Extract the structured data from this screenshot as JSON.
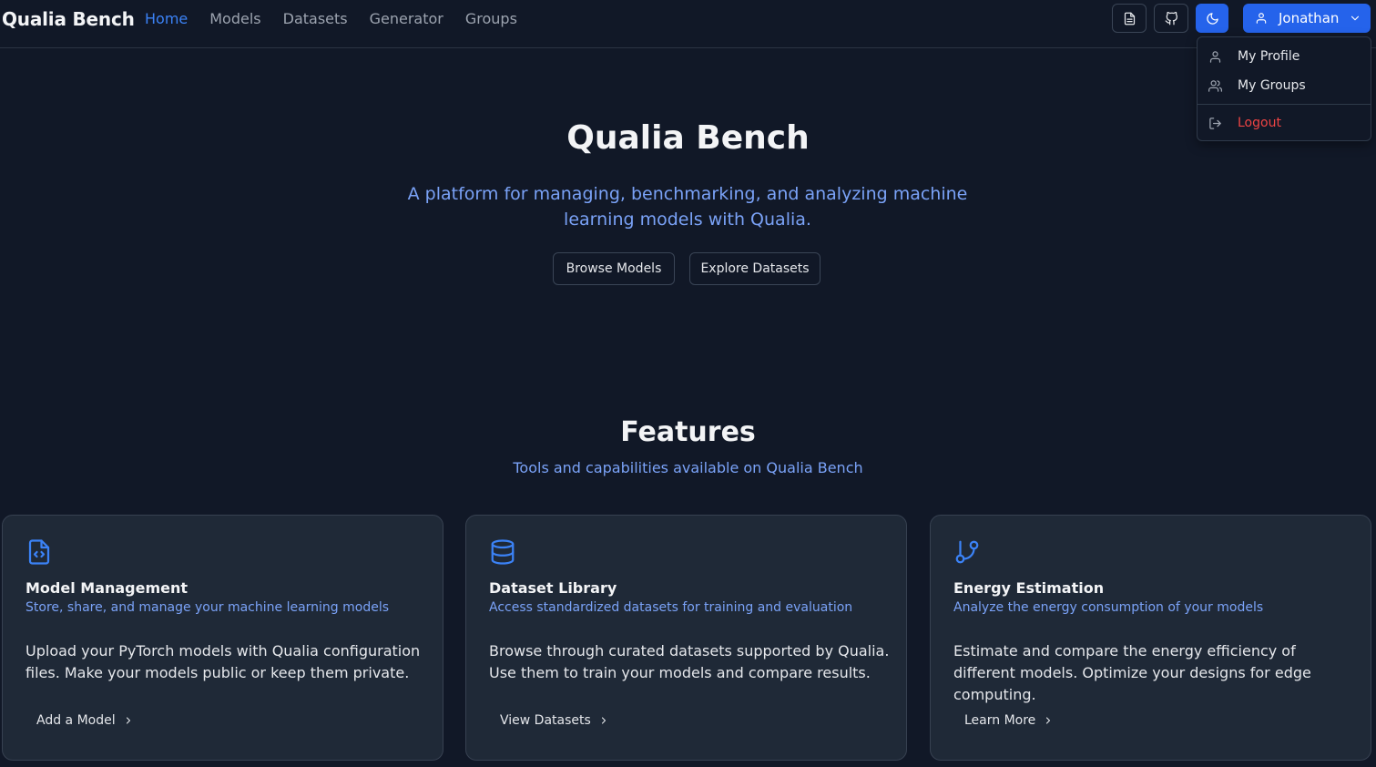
{
  "app": {
    "brand": "Qualia Bench"
  },
  "nav": {
    "items": [
      {
        "label": "Home",
        "active": true
      },
      {
        "label": "Models"
      },
      {
        "label": "Datasets"
      },
      {
        "label": "Generator"
      },
      {
        "label": "Groups"
      }
    ]
  },
  "toolbar": {
    "icons": [
      "document-icon",
      "github-icon",
      "moon-icon"
    ],
    "user_name": "Jonathan"
  },
  "user_menu": {
    "profile_label": "My Profile",
    "groups_label": "My Groups",
    "logout_label": "Logout"
  },
  "hero": {
    "title": "Qualia Bench",
    "subtitle": "A platform for managing, benchmarking, and analyzing machine learning models with Qualia.",
    "browse_label": "Browse Models",
    "explore_label": "Explore Datasets"
  },
  "features": {
    "title": "Features",
    "subtitle": "Tools and capabilities available on Qualia Bench",
    "cards": [
      {
        "icon": "file-code-icon",
        "title": "Model Management",
        "subtitle": "Store, share, and manage your machine learning models",
        "body": "Upload your PyTorch models with Qualia configuration files. Make your models public or keep them private.",
        "link": "Add a Model"
      },
      {
        "icon": "database-icon",
        "title": "Dataset Library",
        "subtitle": "Access standardized datasets for training and evaluation",
        "body": "Browse through curated datasets supported by Qualia. Use them to train your models and compare results.",
        "link": "View Datasets"
      },
      {
        "icon": "git-branch-icon",
        "title": "Energy Estimation",
        "subtitle": "Analyze the energy consumption of your models",
        "body": "Estimate and compare the energy efficiency of different models. Optimize your designs for edge computing.",
        "link": "Learn More"
      }
    ]
  },
  "colors": {
    "background": "#111827",
    "card": "#1f2937",
    "accent": "#3b82f6",
    "danger": "#ef4444"
  }
}
